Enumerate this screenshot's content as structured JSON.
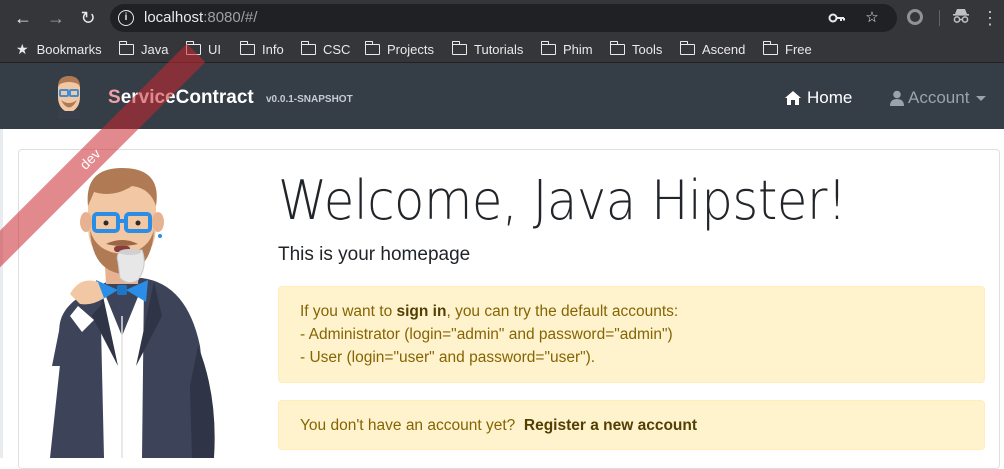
{
  "browser": {
    "url_host": "localhost",
    "url_rest": ":8080/#/",
    "bookmarks_label": "Bookmarks",
    "folders": [
      "Java",
      "UI",
      "Info",
      "CSC",
      "Projects",
      "Tutorials",
      "Phim",
      "Tools",
      "Ascend",
      "Free"
    ]
  },
  "app": {
    "brand_first": "S",
    "brand_rest": "erviceContract",
    "version": "v0.0.1-SNAPSHOT",
    "ribbon": "dev",
    "nav": {
      "home": "Home",
      "account": "Account"
    }
  },
  "home": {
    "title": "Welcome, Java Hipster!",
    "subtitle": "This is your homepage",
    "signin_prefix": "If you want to ",
    "signin_bold": "sign in",
    "signin_suffix": ", you can try the default accounts:",
    "admin_line": "- Administrator (login=\"admin\" and password=\"admin\")",
    "user_line": "- User (login=\"user\" and password=\"user\").",
    "register_prefix": "You don't have an account yet?",
    "register_link": "Register a new account"
  },
  "colors": {
    "navbar": "#353d47",
    "alert_bg": "#fff3cd",
    "alert_text": "#856404",
    "ribbon": "#c8282d"
  }
}
